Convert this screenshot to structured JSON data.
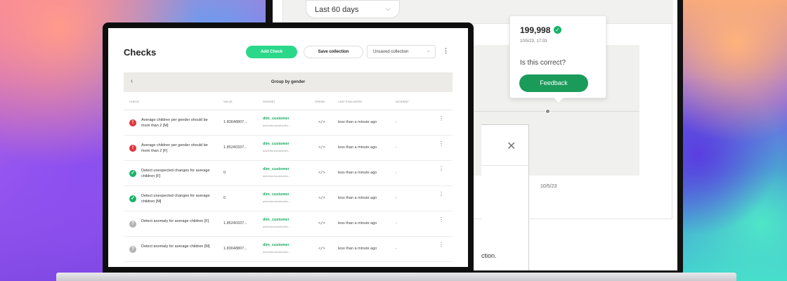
{
  "colors": {
    "accent_green": "#2ad88a",
    "fail_red": "#e0343a",
    "pass_green": "#19b26b",
    "unknown_gray": "#b3b3b3",
    "feedback_green": "#1a9b5a"
  },
  "back_window": {
    "date_range": "Last 60 days",
    "tooltip": {
      "value": "199,998",
      "date": "10/5/23, 17:03",
      "question": "Is this correct?",
      "feedback_label": "Feedback"
    },
    "x_tick": "10/5/23",
    "dialog_fragment": "ction."
  },
  "checks": {
    "title": "Checks",
    "add_check_label": "Add Check",
    "save_collection_label": "Save collection",
    "collection_select": "Unsaved collection",
    "group_label": "Group by gender",
    "columns": [
      "CHECK",
      "VALUE",
      "DATASET",
      "ORIGIN",
      "LAST EVALUATED",
      "INCIDENT"
    ],
    "rows": [
      {
        "status": "fail",
        "status_icon": "alert-icon",
        "name": "Average children per gender should be more than 2 [M]",
        "value": "1.83648807...",
        "dataset": "dim_customer",
        "path": "adventureworks/dim...",
        "origin": "</>",
        "last_evaluated": "less than a minute ago",
        "incident": "-"
      },
      {
        "status": "fail",
        "status_icon": "alert-icon",
        "name": "Average children per gender should be more than 2 [F]",
        "value": "1.85240337...",
        "dataset": "dim_customer",
        "path": "adventureworks/dim...",
        "origin": "</>",
        "last_evaluated": "less than a minute ago",
        "incident": "-"
      },
      {
        "status": "pass",
        "status_icon": "check-icon",
        "name": "Detect unexpected changes for average children [F]",
        "value": "0",
        "dataset": "dim_customer",
        "path": "adventureworks/dim...",
        "origin": "</>",
        "last_evaluated": "less than a minute ago",
        "incident": "-"
      },
      {
        "status": "pass",
        "status_icon": "check-icon",
        "name": "Detect unexpected changes for average children [M]",
        "value": "0",
        "dataset": "dim_customer",
        "path": "adventureworks/dim...",
        "origin": "</>",
        "last_evaluated": "less than a minute ago",
        "incident": "-"
      },
      {
        "status": "unk",
        "status_icon": "question-icon",
        "name": "Detect anomaly for average children [F]",
        "value": "1.85240337...",
        "dataset": "dim_customer",
        "path": "adventureworks/dim...",
        "origin": "</>",
        "last_evaluated": "less than a minute ago",
        "incident": "-"
      },
      {
        "status": "unk",
        "status_icon": "question-icon",
        "name": "Detect anomaly for average children [M]",
        "value": "1.83648807...",
        "dataset": "dim_customer",
        "path": "adventureworks/dim...",
        "origin": "</>",
        "last_evaluated": "less than a minute ago",
        "incident": "-"
      }
    ]
  }
}
